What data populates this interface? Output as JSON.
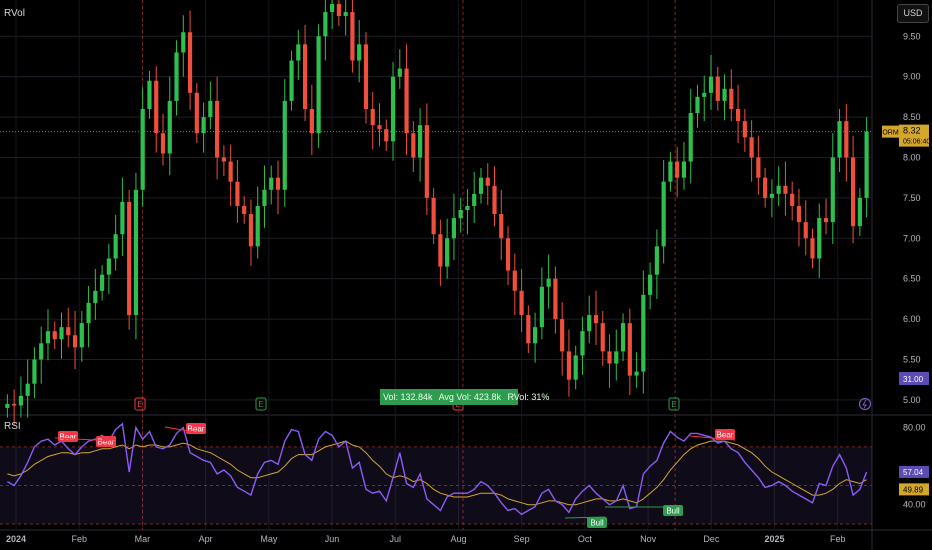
{
  "symbol_label": "RVol",
  "currency": "USD",
  "volume_box": {
    "vol": "Vol: 132.84k",
    "avg": "Avg Vol: 423.8k",
    "rvol": "RVol: 31%"
  },
  "price_label": {
    "name": "ORM",
    "value": "8.32",
    "countdown": "05:06:40"
  },
  "rsi_label": "RSI",
  "colors": {
    "up": "#26a69a",
    "up_candle": "#2fbf4f",
    "down": "#ef4f3c",
    "rsi": "#8b5cf6",
    "rsi_ma": "#d4a72c",
    "band": "rgba(126,87,194,0.12)",
    "bull": "#2e9b4f",
    "bear": "#f23645"
  },
  "chart_data": [
    {
      "type": "candlestick",
      "title": "",
      "y_ticks": [
        "9.50",
        "9.00",
        "8.50",
        "8.00",
        "7.50",
        "7.00",
        "6.50",
        "6.00",
        "5.50",
        "5.00"
      ],
      "ylim": [
        4.85,
        9.85
      ],
      "x_ticks": [
        "2024",
        "Feb",
        "Mar",
        "Apr",
        "May",
        "Jun",
        "Jul",
        "Aug",
        "Sep",
        "Oct",
        "Nov",
        "Dec",
        "2025",
        "Feb"
      ],
      "last_price": 8.32,
      "extra_price_label": "31.00",
      "closes": [
        4.95,
        4.93,
        5.05,
        5.2,
        5.5,
        5.7,
        5.85,
        5.75,
        5.9,
        5.8,
        5.65,
        5.95,
        6.2,
        6.35,
        6.55,
        6.75,
        7.05,
        7.45,
        6.05,
        7.6,
        8.6,
        8.95,
        8.3,
        8.05,
        8.7,
        9.3,
        9.55,
        8.8,
        8.3,
        8.5,
        8.7,
        8.0,
        7.95,
        7.7,
        7.4,
        7.3,
        6.9,
        7.4,
        7.6,
        7.75,
        7.6,
        8.7,
        9.2,
        9.4,
        8.6,
        8.3,
        9.5,
        9.8,
        9.9,
        9.75,
        9.8,
        9.2,
        9.4,
        8.6,
        8.4,
        8.35,
        8.2,
        9.0,
        9.1,
        8.3,
        8.0,
        8.4,
        7.5,
        7.05,
        6.65,
        7.0,
        7.25,
        7.35,
        7.4,
        7.55,
        7.75,
        7.65,
        7.3,
        7.0,
        6.6,
        6.35,
        6.05,
        5.7,
        5.9,
        6.4,
        6.5,
        6.0,
        5.6,
        5.25,
        5.55,
        5.85,
        6.05,
        5.95,
        5.6,
        5.45,
        5.6,
        5.95,
        5.3,
        5.35,
        6.3,
        6.55,
        6.9,
        7.7,
        7.95,
        7.75,
        7.95,
        8.55,
        8.75,
        8.8,
        9.0,
        8.7,
        8.85,
        8.6,
        8.45,
        8.25,
        8.0,
        7.75,
        7.5,
        7.55,
        7.65,
        7.55,
        7.4,
        7.2,
        7.0,
        6.75,
        7.25,
        7.2,
        8.0,
        8.45,
        8.0,
        7.15,
        7.5,
        8.32
      ],
      "rsi": {
        "ylim": [
          30,
          85
        ],
        "ticks": [
          "80.00",
          "40.00"
        ],
        "last": "57.04",
        "ma_last": "49.89",
        "upper_band": 70,
        "lower_band": 30,
        "mid": 50
      },
      "rsi_values": [
        52,
        50,
        55,
        62,
        70,
        73,
        74,
        71,
        73,
        69,
        66,
        70,
        73,
        74,
        76,
        73,
        79,
        82,
        57,
        80,
        74,
        78,
        70,
        69,
        71,
        77,
        80,
        67,
        65,
        63,
        62,
        56,
        58,
        55,
        49,
        47,
        45,
        56,
        62,
        63,
        61,
        73,
        79,
        78,
        66,
        63,
        74,
        78,
        76,
        70,
        73,
        59,
        62,
        48,
        46,
        47,
        42,
        54,
        67,
        51,
        49,
        56,
        43,
        40,
        37,
        44,
        46,
        46,
        46,
        48,
        52,
        50,
        46,
        41,
        37,
        38,
        35,
        37,
        39,
        46,
        48,
        42,
        40,
        36,
        43,
        47,
        50,
        46,
        43,
        40,
        42,
        50,
        38,
        39,
        56,
        60,
        63,
        72,
        78,
        75,
        73,
        77,
        77,
        76,
        75,
        72,
        73,
        69,
        67,
        62,
        58,
        54,
        49,
        50,
        52,
        50,
        47,
        45,
        43,
        41,
        51,
        50,
        60,
        66,
        59,
        45,
        48,
        57
      ],
      "rsi_ma_values": [
        56,
        55,
        56,
        58,
        61,
        63,
        65,
        66,
        67,
        67,
        66,
        67,
        67,
        68,
        69,
        69,
        70,
        71,
        69,
        71,
        70,
        71,
        71,
        70,
        70,
        71,
        72,
        71,
        69,
        68,
        67,
        65,
        63,
        61,
        58,
        56,
        54,
        54,
        55,
        56,
        57,
        60,
        64,
        66,
        66,
        66,
        68,
        70,
        71,
        72,
        73,
        71,
        70,
        67,
        63,
        60,
        56,
        54,
        55,
        54,
        52,
        53,
        51,
        48,
        46,
        45,
        44,
        44,
        44,
        45,
        46,
        46,
        46,
        45,
        43,
        42,
        41,
        40,
        40,
        41,
        42,
        42,
        41,
        40,
        40,
        41,
        42,
        43,
        43,
        42,
        42,
        43,
        42,
        41,
        43,
        46,
        49,
        53,
        58,
        62,
        66,
        69,
        71,
        72,
        73,
        73,
        73,
        72,
        71,
        69,
        67,
        64,
        60,
        57,
        55,
        53,
        51,
        49,
        47,
        45,
        45,
        46,
        48,
        51,
        53,
        52,
        51,
        53
      ],
      "annotations": [
        {
          "text": "Bear",
          "type": "bear"
        },
        {
          "text": "Bear",
          "type": "bear"
        },
        {
          "text": "Bear",
          "type": "bear"
        },
        {
          "text": "Bear",
          "type": "bear"
        },
        {
          "text": "Bull",
          "type": "bull"
        },
        {
          "text": "Bull",
          "type": "bull"
        }
      ],
      "event_markers": [
        "E",
        "E",
        "E",
        "E"
      ]
    }
  ]
}
